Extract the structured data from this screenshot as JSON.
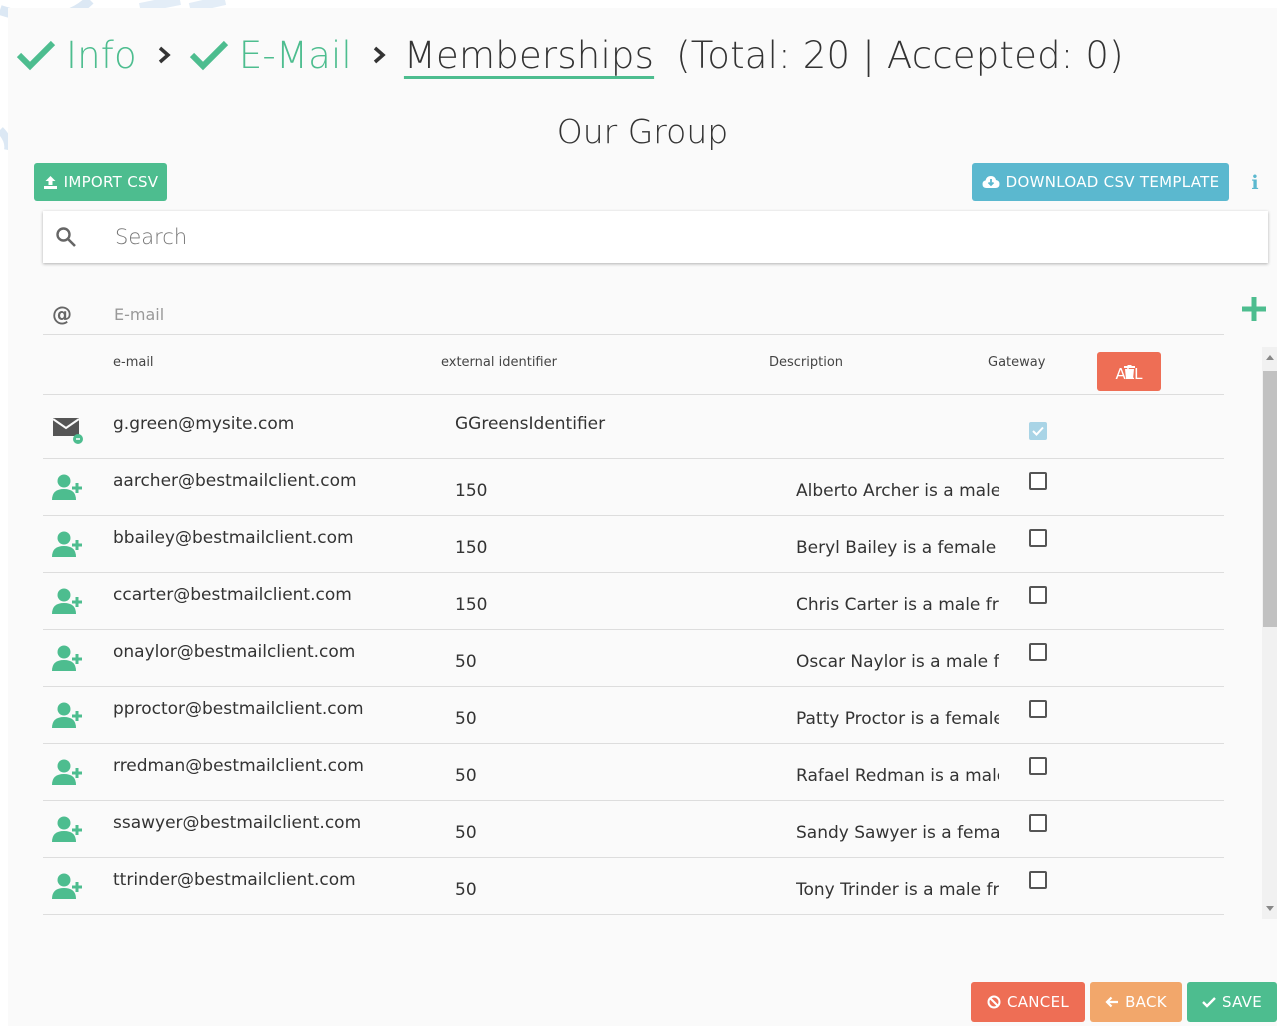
{
  "breadcrumb": {
    "step1": "Info",
    "step2": "E-Mail",
    "current": "Memberships",
    "total": "(Total: 20 | Accepted: 0)"
  },
  "group_title": "Our Group",
  "toolbar": {
    "import_label": "IMPORT CSV",
    "download_label": "DOWNLOAD CSV TEMPLATE",
    "info_icon": "info-icon"
  },
  "search": {
    "placeholder": "Search"
  },
  "new_email": {
    "placeholder": "E-mail"
  },
  "table": {
    "headers": {
      "email": "e-mail",
      "external_identifier": "external identifier",
      "description": "Description",
      "gateway": "Gateway",
      "delete_all": "ALL"
    },
    "rows": [
      {
        "icon": "envelope-icon",
        "email": "g.green@mysite.com",
        "external_identifier": "GGreensIdentifier",
        "description": "",
        "gateway": true
      },
      {
        "icon": "add-user-icon",
        "email": "aarcher@bestmailclient.com",
        "external_identifier": "150",
        "description": "Alberto Archer is a male f",
        "gateway": false
      },
      {
        "icon": "add-user-icon",
        "email": "bbailey@bestmailclient.com",
        "external_identifier": "150",
        "description": "Beryl Bailey is a female fr",
        "gateway": false
      },
      {
        "icon": "add-user-icon",
        "email": "ccarter@bestmailclient.com",
        "external_identifier": "150",
        "description": "Chris Carter is a male fror",
        "gateway": false
      },
      {
        "icon": "add-user-icon",
        "email": "onaylor@bestmailclient.com",
        "external_identifier": "50",
        "description": "Oscar Naylor is a male frc",
        "gateway": false
      },
      {
        "icon": "add-user-icon",
        "email": "pproctor@bestmailclient.com",
        "external_identifier": "50",
        "description": "Patty Proctor is a female '",
        "gateway": false
      },
      {
        "icon": "add-user-icon",
        "email": "rredman@bestmailclient.com",
        "external_identifier": "50",
        "description": "Rafael Redman is a male",
        "gateway": false
      },
      {
        "icon": "add-user-icon",
        "email": "ssawyer@bestmailclient.com",
        "external_identifier": "50",
        "description": "Sandy Sawyer is a female",
        "gateway": false
      },
      {
        "icon": "add-user-icon",
        "email": "ttrinder@bestmailclient.com",
        "external_identifier": "50",
        "description": "Tony Trinder is a male fro",
        "gateway": false
      }
    ]
  },
  "footer": {
    "cancel_label": "CANCEL",
    "back_label": "BACK",
    "save_label": "SAVE"
  },
  "colors": {
    "green": "#4dbd8f",
    "teal": "#5bb8cf",
    "red": "#ee6e55",
    "orange": "#f2a76b",
    "checked": "#a9d4e6"
  }
}
